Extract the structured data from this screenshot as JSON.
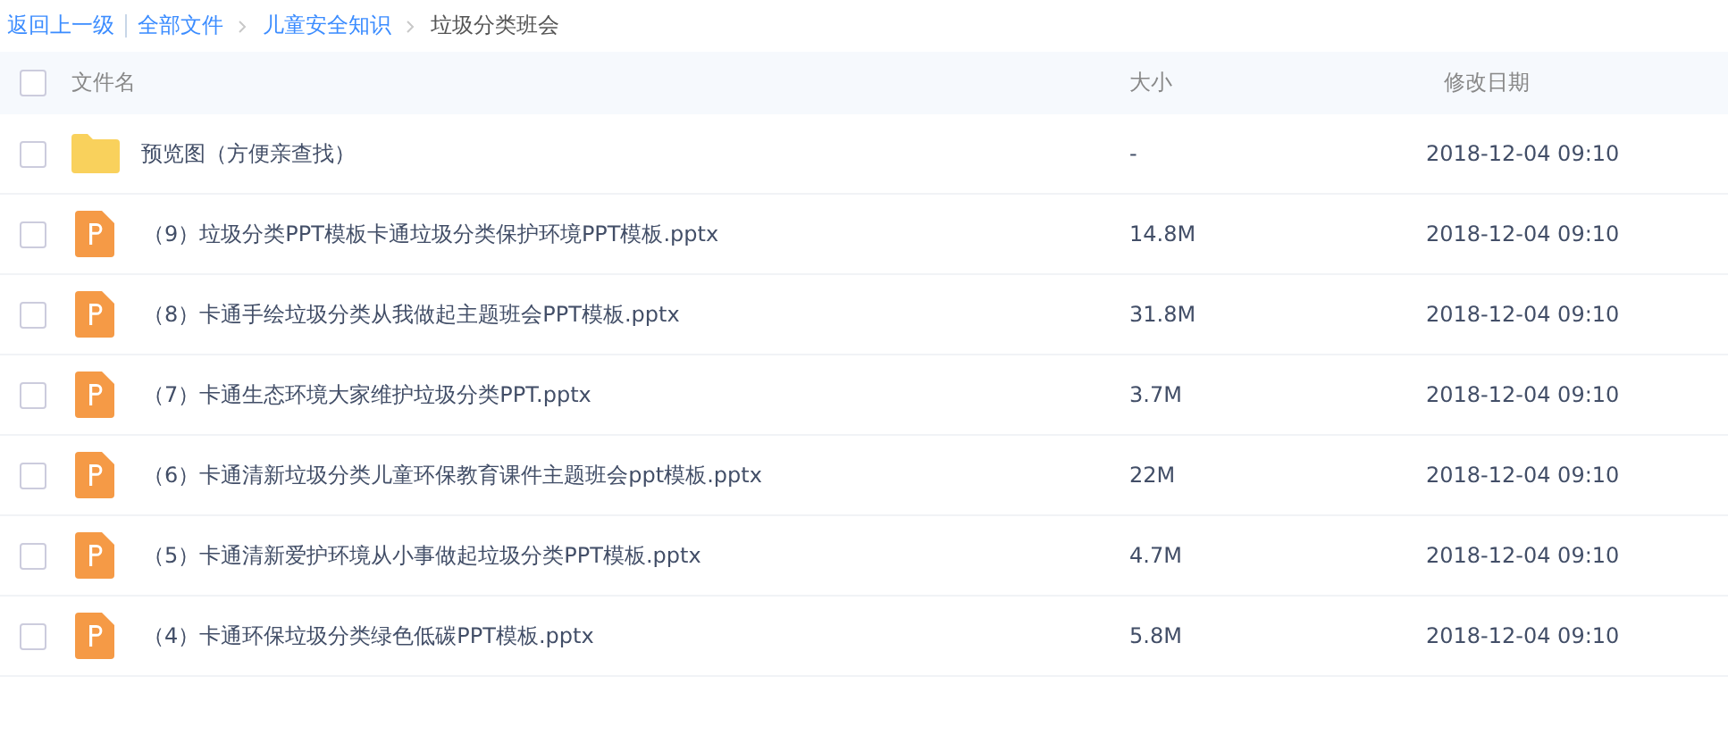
{
  "breadcrumb": {
    "back": "返回上一级",
    "links": [
      "全部文件",
      "儿童安全知识"
    ],
    "current": "垃圾分类班会"
  },
  "table": {
    "columns": [
      "文件名",
      "大小",
      "修改日期"
    ],
    "header_checked": false,
    "rows": [
      {
        "kind": "folder",
        "name": "预览图（方便亲查找）",
        "size": "-",
        "date": "2018-12-04 09:10",
        "checked": false
      },
      {
        "kind": "ppt",
        "name": "（9）垃圾分类PPT模板卡通垃圾分类保护环境PPT模板.pptx",
        "size": "14.8M",
        "date": "2018-12-04 09:10",
        "checked": false
      },
      {
        "kind": "ppt",
        "name": "（8）卡通手绘垃圾分类从我做起主题班会PPT模板.pptx",
        "size": "31.8M",
        "date": "2018-12-04 09:10",
        "checked": false
      },
      {
        "kind": "ppt",
        "name": "（7）卡通生态环境大家维护垃圾分类PPT.pptx",
        "size": "3.7M",
        "date": "2018-12-04 09:10",
        "checked": false
      },
      {
        "kind": "ppt",
        "name": "（6）卡通清新垃圾分类儿童环保教育课件主题班会ppt模板.pptx",
        "size": "22M",
        "date": "2018-12-04 09:10",
        "checked": false
      },
      {
        "kind": "ppt",
        "name": "（5）卡通清新爱护环境从小事做起垃圾分类PPT模板.pptx",
        "size": "4.7M",
        "date": "2018-12-04 09:10",
        "checked": false
      },
      {
        "kind": "ppt",
        "name": "（4）卡通环保垃圾分类绿色低碳PPT模板.pptx",
        "size": "5.8M",
        "date": "2018-12-04 09:10",
        "checked": false
      }
    ]
  }
}
